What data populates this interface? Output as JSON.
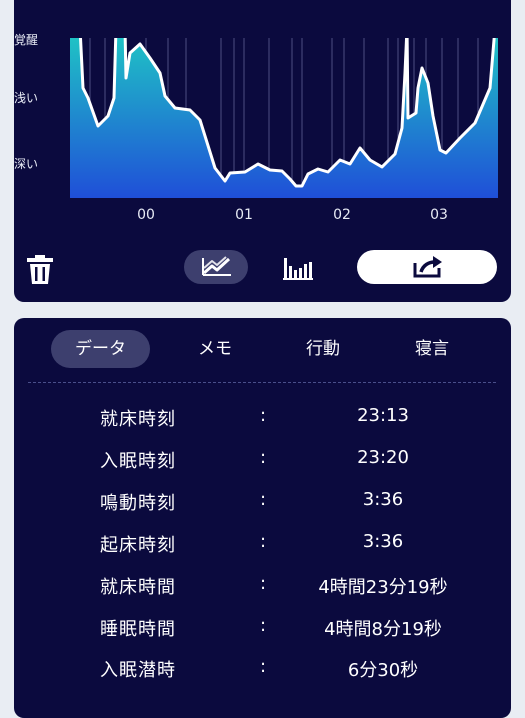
{
  "chart": {
    "y_labels": [
      "覚醒",
      "浅い",
      "深い"
    ],
    "x_labels": [
      "00",
      "01",
      "02",
      "03"
    ],
    "colors": {
      "top": "#1fc9c4",
      "bottom": "#1f4fd8",
      "line": "#ffffff",
      "card": "#0b0a3e"
    }
  },
  "toolbar": {
    "delete_icon": "trash-icon",
    "line_chart_icon": "line-chart-icon",
    "bar_chart_icon": "bar-chart-icon",
    "share_icon": "share-icon"
  },
  "tabs": [
    {
      "label": "データ",
      "active": true
    },
    {
      "label": "メモ",
      "active": false
    },
    {
      "label": "行動",
      "active": false
    },
    {
      "label": "寝言",
      "active": false
    }
  ],
  "details": {
    "separator": ":",
    "rows": [
      {
        "label": "就床時刻",
        "value": "23:13"
      },
      {
        "label": "入眠時刻",
        "value": "23:20"
      },
      {
        "label": "鳴動時刻",
        "value": "3:36"
      },
      {
        "label": "起床時刻",
        "value": "3:36"
      },
      {
        "label": "就床時間",
        "value": "4時間23分19秒"
      },
      {
        "label": "睡眠時間",
        "value": "4時間8分19秒"
      },
      {
        "label": "入眠潜時",
        "value": "6分30秒"
      }
    ]
  }
}
